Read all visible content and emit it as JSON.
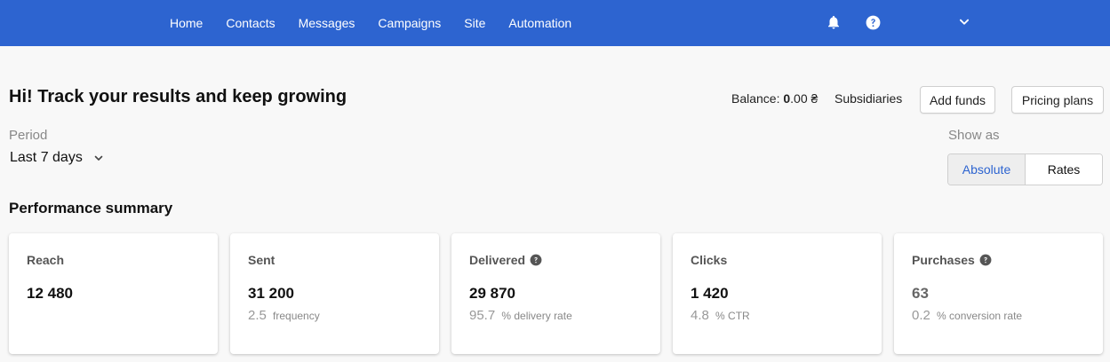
{
  "nav": {
    "links": [
      "Home",
      "Contacts",
      "Messages",
      "Campaigns",
      "Site",
      "Automation"
    ],
    "icons": [
      "bell-icon",
      "help-icon",
      "chevron-down-icon"
    ]
  },
  "colors": {
    "brand": "#2d64d0",
    "background": "#f8f8f8"
  },
  "header": {
    "greeting": "Hi! Track your results and keep growing",
    "balance_label": "Balance:",
    "balance_integer": "0",
    "balance_decimal": ".00",
    "currency": "₴",
    "subsidiaries": "Subsidiaries",
    "add_funds": "Add funds",
    "pricing_plans": "Pricing plans"
  },
  "period": {
    "label": "Period",
    "value": "Last 7 days"
  },
  "show_as": {
    "label": "Show as",
    "options": [
      "Absolute",
      "Rates"
    ],
    "selected": "Absolute"
  },
  "summary": {
    "title": "Performance summary",
    "cards": [
      {
        "title": "Reach",
        "value": "12 480",
        "sub_value": "",
        "sub_unit": ""
      },
      {
        "title": "Sent",
        "value": "31 200",
        "sub_value": "2.5",
        "sub_unit": "frequency"
      },
      {
        "title": "Delivered",
        "value": "29 870",
        "sub_value": "95.7",
        "sub_unit": "% delivery rate"
      },
      {
        "title": "Clicks",
        "value": "1 420",
        "sub_value": "4.8",
        "sub_unit": "% CTR"
      },
      {
        "title": "Purchases",
        "value": "63",
        "sub_value": "0.2",
        "sub_unit": "% conversion rate"
      }
    ]
  }
}
